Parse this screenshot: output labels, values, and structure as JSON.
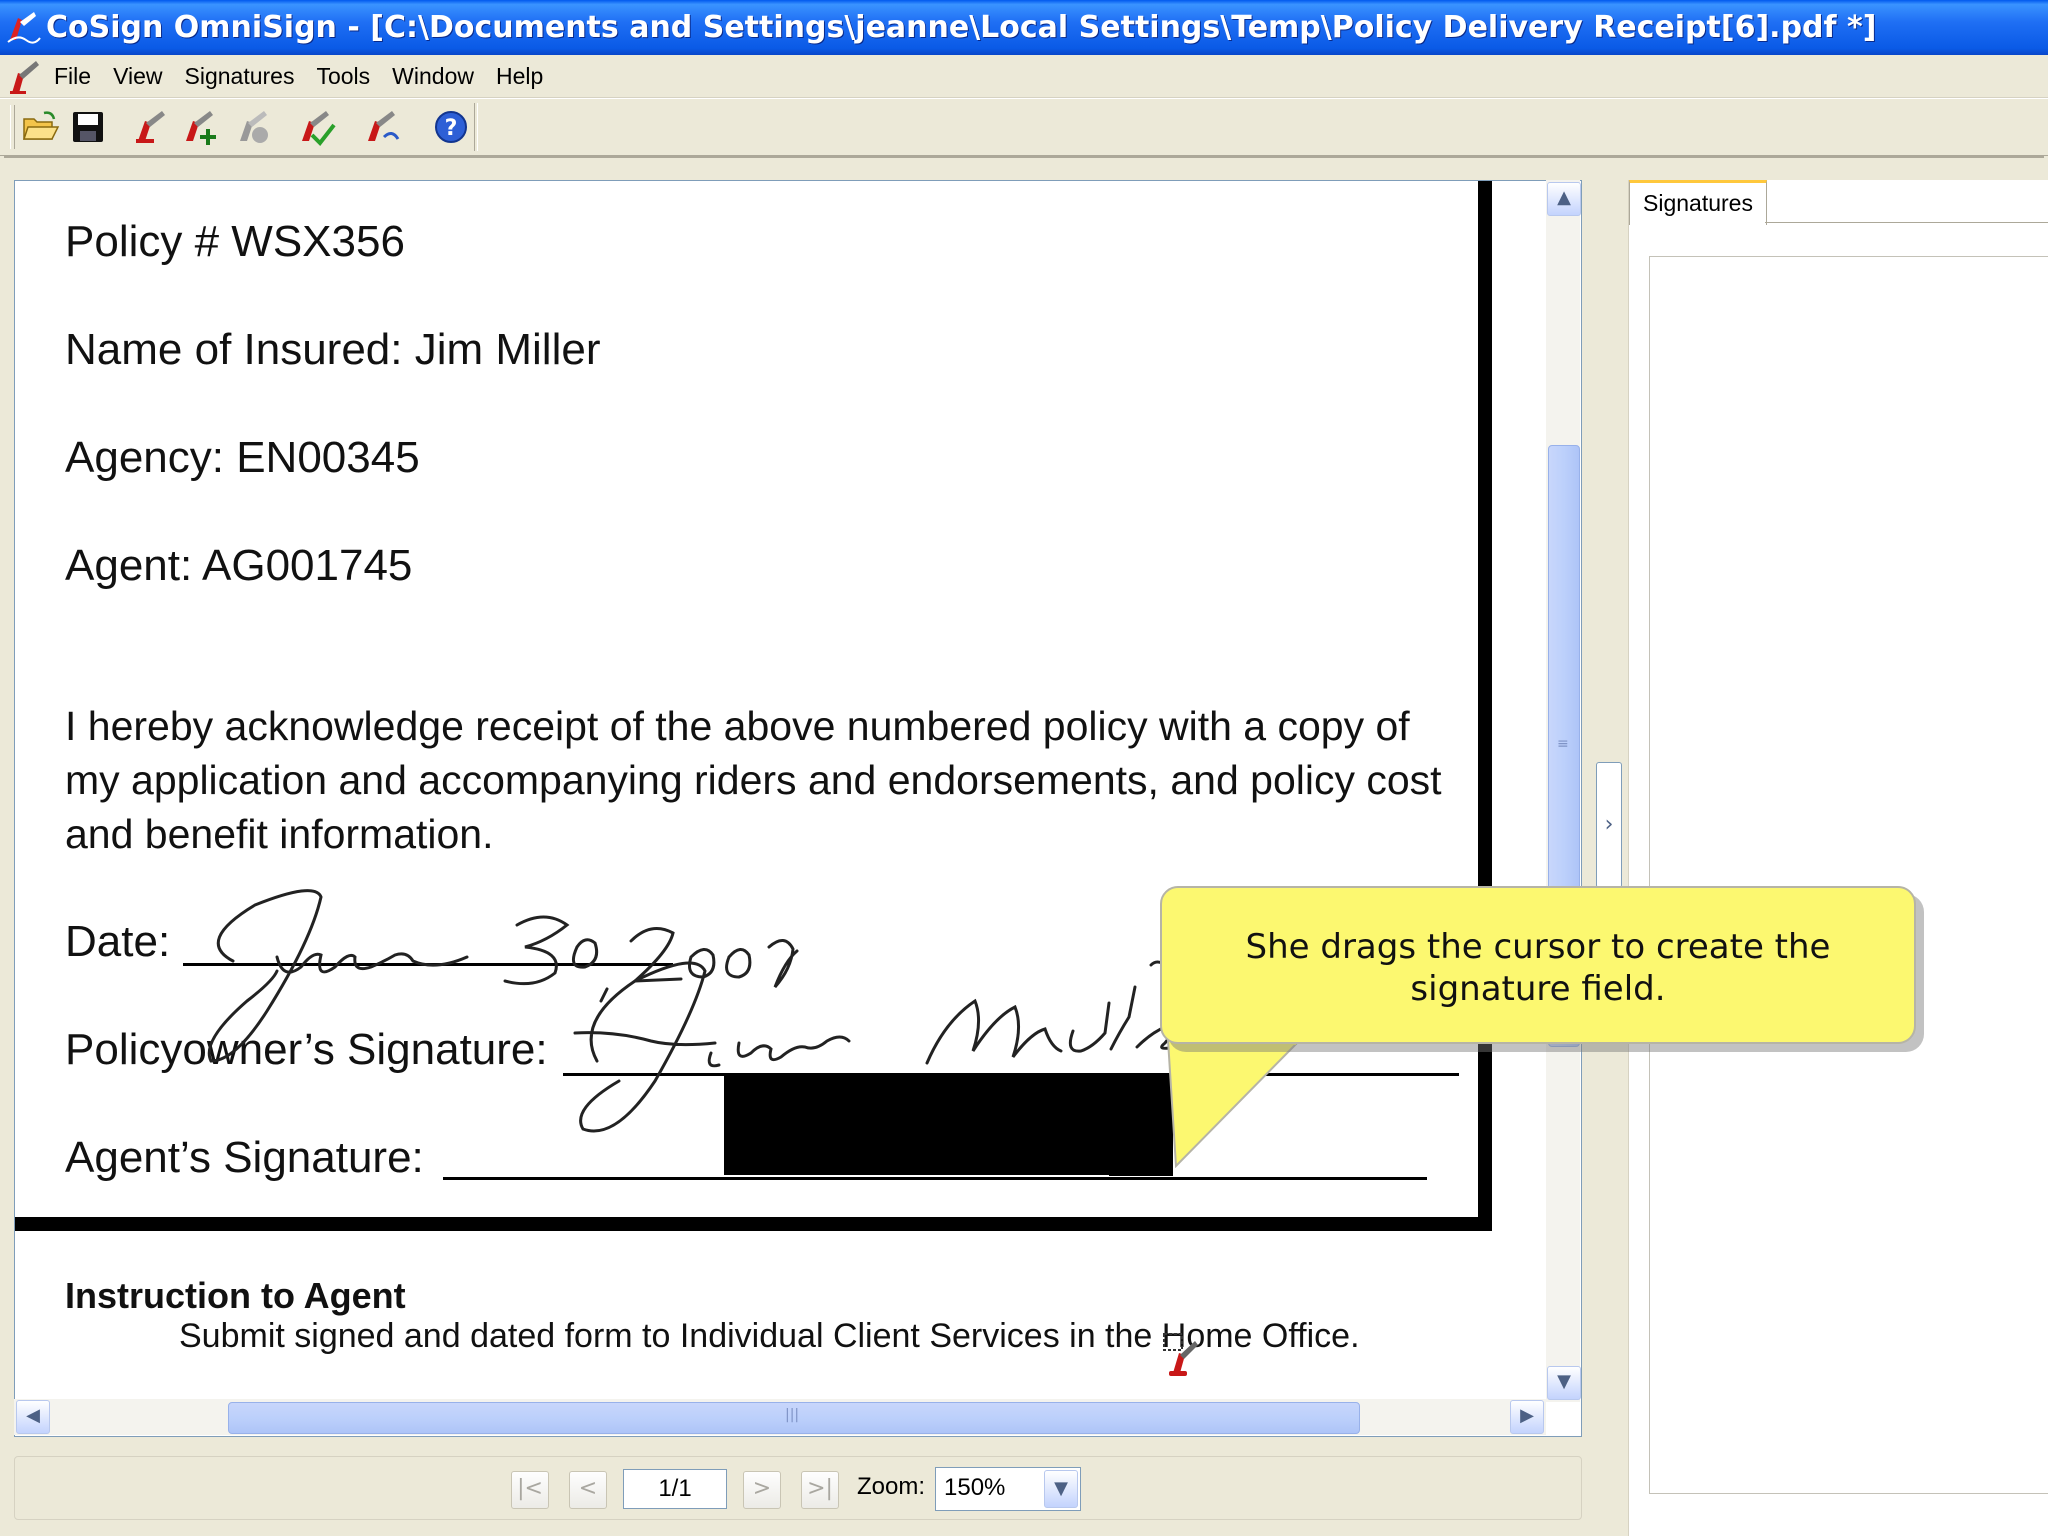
{
  "window": {
    "title": "CoSign OmniSign - [C:\\Documents and Settings\\jeanne\\Local Settings\\Temp\\Policy Delivery Receipt[6].pdf *]"
  },
  "menu": {
    "items": [
      "File",
      "View",
      "Signatures",
      "Tools",
      "Window",
      "Help"
    ]
  },
  "toolbar": {
    "buttons": [
      {
        "name": "open-icon"
      },
      {
        "name": "save-icon"
      },
      {
        "name": "sign-icon"
      },
      {
        "name": "add-signature-field-icon"
      },
      {
        "name": "clear-signature-icon"
      },
      {
        "name": "verify-signature-icon"
      },
      {
        "name": "signature-properties-icon"
      },
      {
        "name": "help-icon"
      }
    ]
  },
  "document": {
    "policy": "Policy # WSX356",
    "insured": "Name of Insured:  Jim Miller",
    "agency": "Agency:  EN00345",
    "agent": "Agent: AG001745",
    "acknowledgement": "I hereby acknowledge receipt of the above numbered policy with a copy of my application and accompanying riders and endorsements, and policy cost and benefit information.",
    "date_label": "Date:",
    "date_handwritten": "June 30, 2009",
    "policyowner_sig_label": "Policyowner’s Signature:",
    "policyowner_sig_handwritten": "Jim Miller",
    "agent_sig_label": "Agent’s Signature:",
    "instruction_title": "Instruction to Agent",
    "instruction_text": "Submit signed and dated form to Individual Client Services in the Home Office."
  },
  "navigation": {
    "first": "|<",
    "prev": "<",
    "page": "1/1",
    "next": ">",
    "last": ">|",
    "zoom_label": "Zoom:",
    "zoom_value": "150%"
  },
  "signatures_panel": {
    "tab_label": "Signatures"
  },
  "callout": {
    "text": "She drags the cursor to create the signature field."
  },
  "colors": {
    "titlebar": "#0a5ae6",
    "callout": "#fcf870",
    "scroll_thumb": "#bcd0fb"
  }
}
